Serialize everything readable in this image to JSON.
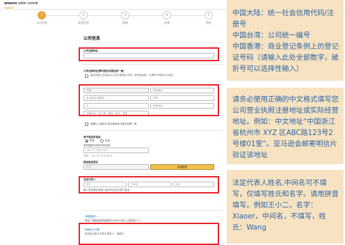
{
  "header": {
    "logo_main": "amazon",
    "logo_sub": "seller central"
  },
  "steps": [
    {
      "num": "1",
      "label": "公司信息"
    },
    {
      "num": "2",
      "label": "卖家信息"
    },
    {
      "num": "3",
      "label": "账单"
    },
    {
      "num": "4",
      "label": "店铺"
    },
    {
      "num": "5",
      "label": "验证"
    }
  ],
  "form": {
    "section_title": "公司信息",
    "reg_label": "公司注册地址",
    "reg_check_note": "营业执照上的地址与公司注册地址不同，请勾选此框，可提供不同的办公地址",
    "addr_label": "公司注册地址(需与营业执照信息一致)",
    "addr_fields": {
      "country": "中国",
      "postcode": "邮政编码",
      "province": "省/自治区/直辖市",
      "city": "城市",
      "district": "区",
      "street": "街道地址",
      "street2": "详细地址：如公寓、套房、单元、楼层"
    },
    "addr_confirm": "我确认上面的公司注册地址与营业执照一致",
    "phone_label": "用于验证的电话",
    "phone_sms": "短信",
    "phone_call": "电话",
    "phone_sub": "带有国家代码的手机号码",
    "phone_value": "+86 131 2345 6789",
    "phone_hint": "例如：+86 139 1234 5678",
    "lang_label": "短信验证语言",
    "lang_value": "中文",
    "save_button": "发送短信",
    "legal_label": "法定代表人",
    "legal_first": "名字",
    "legal_middle": "中间名",
    "legal_last": "姓氏",
    "legal_note": "输入您在营业执照上显示的法定代表人姓名",
    "link1": "添加受益人",
    "link1_detail": "受益人是直接或间接拥有公司25%及以上股权的个人",
    "link2": "添加法人代表",
    "link2_detail": "如法定代表人不同于您本人，请填写"
  },
  "annotations": {
    "top": "中国大陆：统一社会信用代码/注册号\n中国台湾：公司统一编号\n中国香港：商业登记条例上的登记证号码（请输入此处全部数字，破折号可以选择性输入）",
    "middle": "请务必使用正确的中文格式填写您公司营业执照注册地址或实际经营地址。例如：中文地址“中国浙江省杭州市 XYZ 区ABC路123号2号楼01室”。亚马逊会邮寄明信片验证该地址",
    "bottom": "法定代表人姓名,中间名可不填写，仅填写姓氏和名字。请用拼音填写。例如王小二，名字：Xiaoer，中间名，不填写，姓氏：Wang"
  },
  "colors": {
    "accent": "#e8a33d",
    "highlight": "#e8232a",
    "annotation_bg": "#f7e3c2",
    "annotation_text": "#2c64a4"
  }
}
